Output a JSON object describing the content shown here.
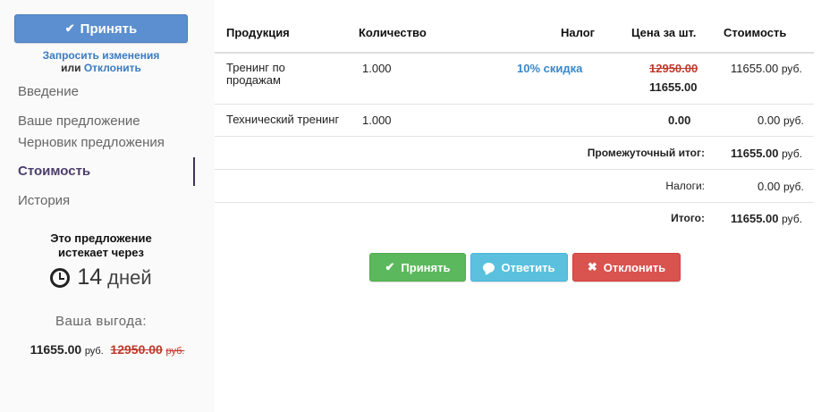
{
  "sidebar": {
    "accept_button": "Принять",
    "request_changes": "Запросить изменения",
    "or_text": "или",
    "decline_link": "Отклонить",
    "nav": [
      "Введение",
      "Ваше предложение",
      "Черновик предложения",
      "Стоимость",
      "История"
    ],
    "active_nav": "Стоимость",
    "expires_line1": "Это предложение",
    "expires_line2": "истекает через",
    "days_number": "14",
    "days_word": "дней",
    "benefit_label": "Ваша выгода:",
    "benefit_new": "11655.00",
    "benefit_new_currency": "руб.",
    "benefit_old": "12950.00",
    "benefit_old_currency": "руб."
  },
  "table": {
    "headers": {
      "product": "Продукция",
      "quantity": "Количество",
      "tax": "Налог",
      "unit_price": "Цена за шт.",
      "cost": "Стоимость"
    },
    "rows": [
      {
        "product_line1": "Тренинг по",
        "product_line2": "продажам",
        "quantity": "1.000",
        "tax": "10% скидка",
        "price_old": "12950.00",
        "price_new": "11655.00",
        "cost": "11655.00",
        "currency": "руб."
      },
      {
        "product": "Технический тренинг",
        "quantity": "1.000",
        "price": "0.00",
        "cost": "0.00",
        "currency": "руб."
      }
    ],
    "subtotal_label": "Промежуточный итог:",
    "subtotal_value": "11655.00",
    "taxes_label": "Налоги:",
    "taxes_value": "0.00",
    "total_label": "Итого:",
    "total_value": "11655.00",
    "currency": "руб."
  },
  "actions": {
    "accept": "Принять",
    "reply": "Ответить",
    "decline": "Отклонить"
  },
  "colors": {
    "accept_top": "#5b8fcf",
    "accept": "#5cb85c",
    "reply": "#5bc0de",
    "decline": "#d9534f",
    "strike": "#c0392b",
    "discount": "#3a88c9"
  }
}
